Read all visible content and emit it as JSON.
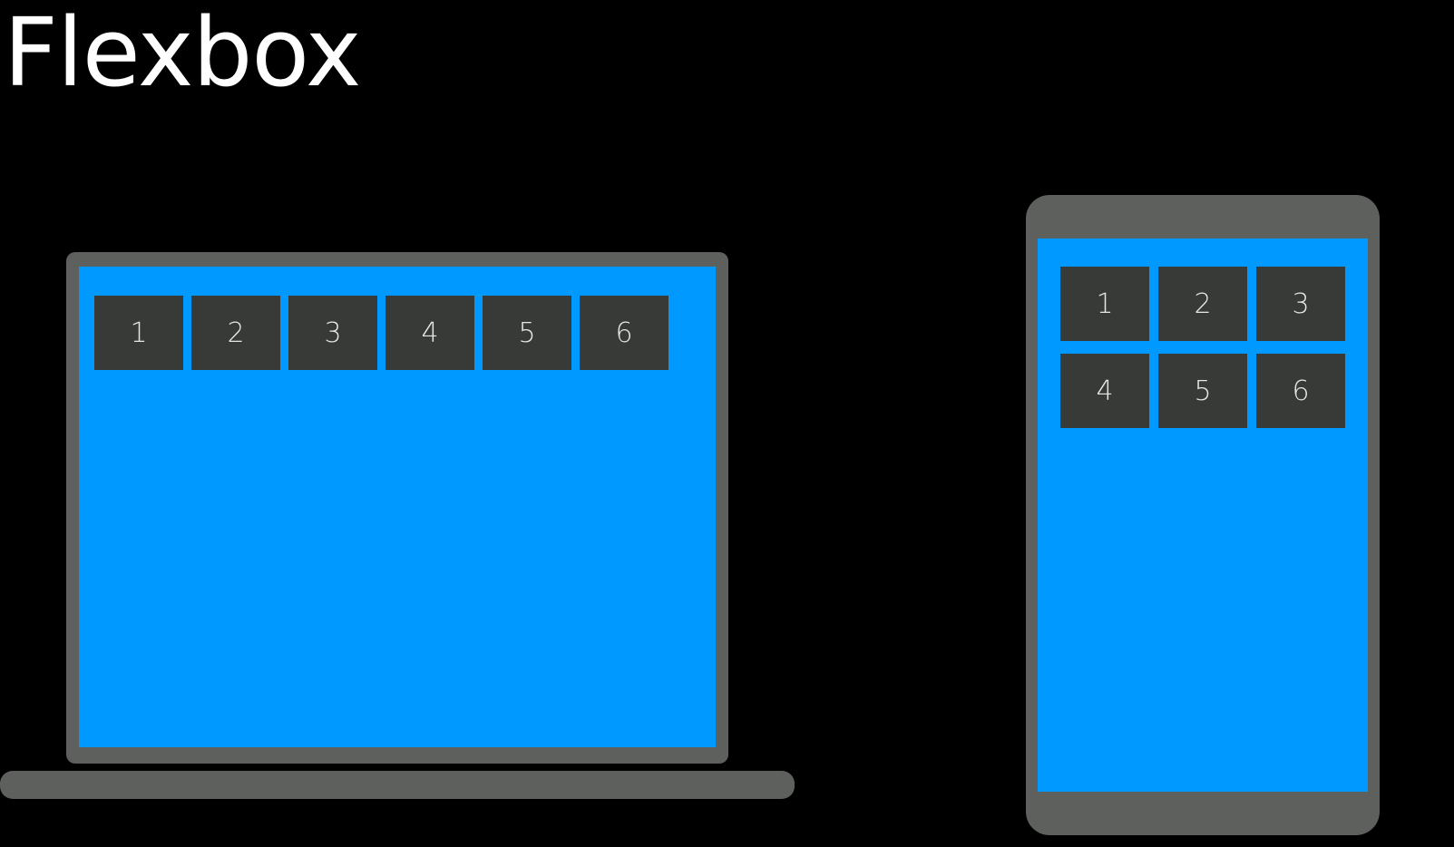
{
  "title": "Flexbox",
  "colors": {
    "background": "#000000",
    "device_frame": "#5d605c",
    "screen": "#0099ff",
    "tile": "#373a37",
    "tile_text": "#e6e6e6",
    "title_text": "#ffffff"
  },
  "laptop": {
    "items": [
      "1",
      "2",
      "3",
      "4",
      "5",
      "6"
    ]
  },
  "phone": {
    "items": [
      "1",
      "2",
      "3",
      "4",
      "5",
      "6"
    ]
  }
}
